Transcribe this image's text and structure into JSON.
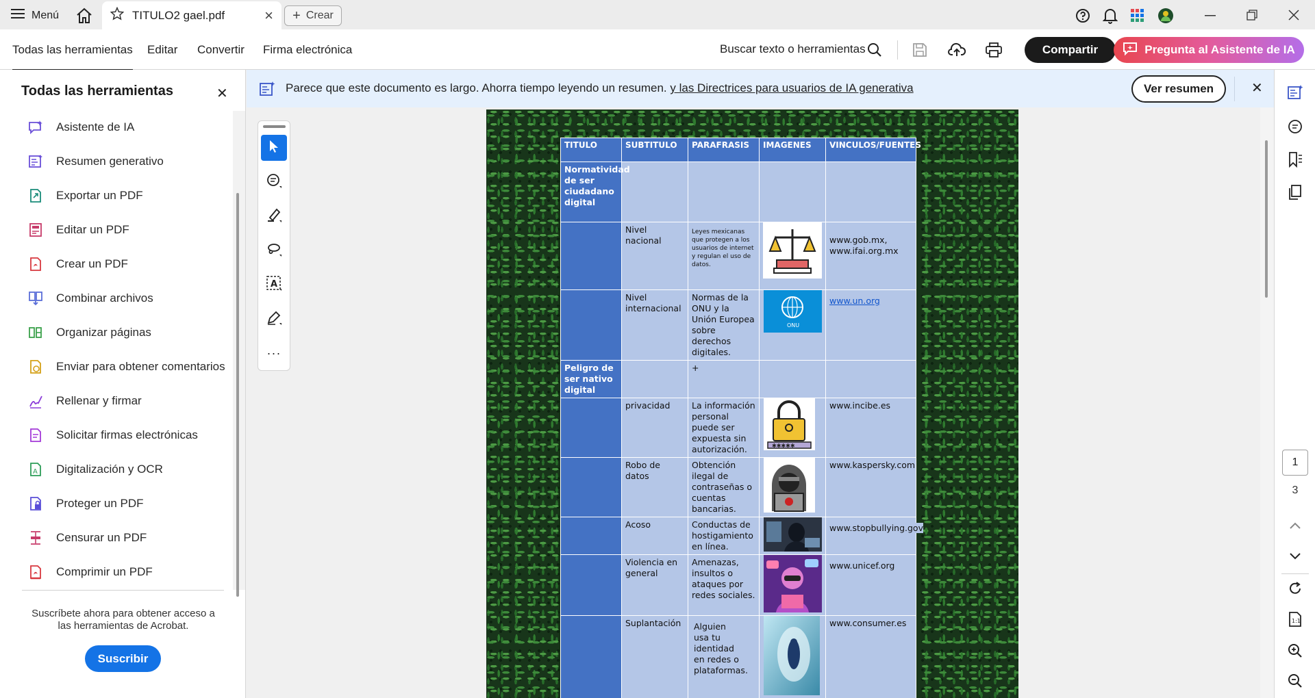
{
  "titlebar": {
    "menu_label": "Menú",
    "tab_title": "TITULO2 gael.pdf",
    "create_label": "Crear"
  },
  "toolbar": {
    "nav": [
      "Todas las herramientas",
      "Editar",
      "Convertir",
      "Firma electrónica"
    ],
    "search_label": "Buscar texto o herramientas",
    "share_label": "Compartir",
    "ai_label": "Pregunta al Asistente de IA"
  },
  "left_panel": {
    "title": "Todas las herramientas",
    "tools": [
      {
        "label": "Asistente de IA",
        "icon": "ai-assistant-icon"
      },
      {
        "label": "Resumen generativo",
        "icon": "generative-summary-icon"
      },
      {
        "label": "Exportar un PDF",
        "icon": "export-pdf-icon"
      },
      {
        "label": "Editar un PDF",
        "icon": "edit-pdf-icon"
      },
      {
        "label": "Crear un PDF",
        "icon": "create-pdf-icon"
      },
      {
        "label": "Combinar archivos",
        "icon": "combine-files-icon"
      },
      {
        "label": "Organizar páginas",
        "icon": "organize-pages-icon"
      },
      {
        "label": "Enviar para obtener comentarios",
        "icon": "send-comments-icon"
      },
      {
        "label": "Rellenar y firmar",
        "icon": "fill-sign-icon"
      },
      {
        "label": "Solicitar firmas electrónicas",
        "icon": "request-signatures-icon"
      },
      {
        "label": "Digitalización y OCR",
        "icon": "scan-ocr-icon"
      },
      {
        "label": "Proteger un PDF",
        "icon": "protect-pdf-icon"
      },
      {
        "label": "Censurar un PDF",
        "icon": "redact-pdf-icon"
      },
      {
        "label": "Comprimir un PDF",
        "icon": "compress-pdf-icon"
      }
    ],
    "subscribe_text": "Suscríbete ahora para obtener acceso a las herramientas de Acrobat.",
    "subscribe_button": "Suscribir"
  },
  "banner": {
    "text": "Parece que este documento es largo. Ahorra tiempo leyendo un resumen.",
    "link": "y las Directrices para usuarios de IA generativa",
    "button": "Ver resumen"
  },
  "page_nav": {
    "current": "1",
    "total": "3"
  },
  "document": {
    "headers": [
      "TITULO",
      "SUBTITULO",
      "PARAFRASIS",
      "IMAGENES",
      "VINCULOS/FUENTES"
    ],
    "rows": [
      {
        "titulo": "Normatividad de ser ciudadano digital",
        "subtitulo": "",
        "parafrasis": "",
        "imagen": "",
        "vinculo": ""
      },
      {
        "titulo": "",
        "subtitulo": "Nivel nacional",
        "parafrasis": "Leyes mexicanas que protegen a los usuarios de internet y regulan el uso de datos.",
        "imagen": "scales-of-justice-icon",
        "vinculo": "www.gob.mx, www.ifai.org.mx"
      },
      {
        "titulo": "",
        "subtitulo": "Nivel internacional",
        "parafrasis": "Normas de la ONU y la Unión Europea sobre derechos digitales.",
        "imagen": "un-logo-icon",
        "imagen_text": "ONU",
        "vinculo": "www.un.org"
      },
      {
        "titulo": "Peligro de ser nativo digital",
        "subtitulo": "",
        "parafrasis": "+",
        "imagen": "",
        "vinculo": ""
      },
      {
        "titulo": "",
        "subtitulo": "privacidad",
        "parafrasis": "La información personal puede ser expuesta sin autorización.",
        "imagen": "padlock-password-icon",
        "vinculo": "www.incibe.es"
      },
      {
        "titulo": "",
        "subtitulo": "Robo de datos",
        "parafrasis": "Obtención ilegal de contraseñas o cuentas bancarias.",
        "imagen": "hacker-icon",
        "vinculo": "www.kaspersky.com"
      },
      {
        "titulo": "",
        "subtitulo": "Acoso",
        "parafrasis": "Conductas de hostigamiento en línea.",
        "imagen": "cyberbullying-photo",
        "vinculo": "www.stopbullying.gov"
      },
      {
        "titulo": "",
        "subtitulo": "Violencia en general",
        "parafrasis": "Amenazas, insultos o ataques por redes sociales.",
        "imagen": "online-violence-illustration",
        "vinculo": "www.unicef.org"
      },
      {
        "titulo": "",
        "subtitulo": "Suplantación",
        "parafrasis": "Alguien usa tu identidad en redes o plataformas.",
        "imagen": "identity-theft-illustration",
        "vinculo": "www.consumer.es"
      }
    ]
  },
  "colors": {
    "accent_blue": "#1473e6",
    "table_header": "#4472c4",
    "table_cell": "#b4c6e7",
    "banner_bg": "#e5f0fd",
    "ai_gradient_start": "#e8464f",
    "ai_gradient_end": "#b46ee8"
  }
}
